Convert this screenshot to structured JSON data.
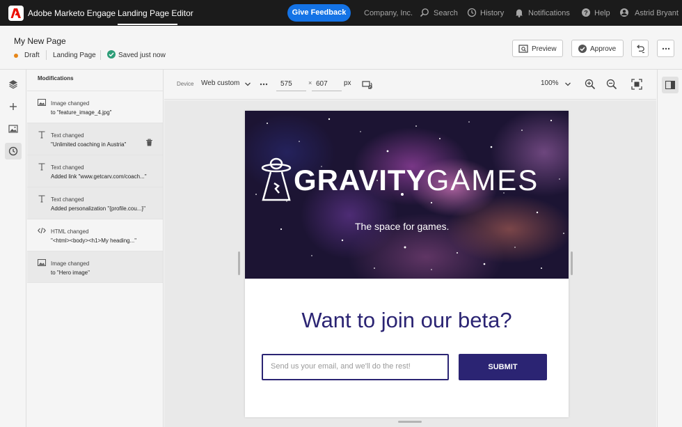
{
  "app": {
    "name": "Adobe Marketo Engage",
    "active_tab": "Landing Page Editor",
    "feedback_label": "Give Feedback",
    "nav": {
      "company": "Company, Inc.",
      "search": "Search",
      "history": "History",
      "notifications": "Notifications",
      "help": "Help",
      "user": "Astrid Bryant"
    }
  },
  "page": {
    "title": "My New Page",
    "status": "Draft",
    "type": "Landing Page",
    "saved": "Saved just now",
    "status_color": "#e68619",
    "saved_color": "#2d9d78",
    "actions": {
      "preview": "Preview",
      "approve": "Approve"
    }
  },
  "rail": {
    "icons": [
      "layers-icon",
      "add-icon",
      "image-icon",
      "history-icon"
    ],
    "active": "history-icon"
  },
  "modifications": {
    "title": "Modifications",
    "items": [
      {
        "icon": "image-icon",
        "title": "Image changed",
        "description": "to \"feature_image_4.jpg\""
      },
      {
        "icon": "text-icon",
        "title": "Text changed",
        "description": "\"Unlimited coaching in Austria\""
      },
      {
        "icon": "text-icon",
        "title": "Text changed",
        "description": "Added link \"www.getcarv.com/coach...\""
      },
      {
        "icon": "text-icon",
        "title": "Text changed",
        "description": "Added personalization \"{profile.cou...}\""
      },
      {
        "icon": "code-icon",
        "title": "HTML changed",
        "description": "\"<html><body><h1>My heading...\""
      },
      {
        "icon": "image-icon",
        "title": "Image changed",
        "description": "to \"Hero image\""
      }
    ]
  },
  "toolbar": {
    "device_label": "Device",
    "device_value": "Web custom",
    "width": "575",
    "times": "×",
    "height": "607",
    "unit": "px",
    "zoom": "100%"
  },
  "landing_page": {
    "brand_bold": "GRAVITY",
    "brand_light": "GAMES",
    "tagline": "The space for games.",
    "heading": "Want to join our beta?",
    "email_placeholder": "Send us your email, and we'll do the rest!",
    "submit_label": "SUBMIT",
    "accent_color": "#2b2473"
  },
  "colors": {
    "topbar": "#1b1b1b",
    "feedback_button": "#1473e6",
    "adobe_red": "#eb1000"
  }
}
